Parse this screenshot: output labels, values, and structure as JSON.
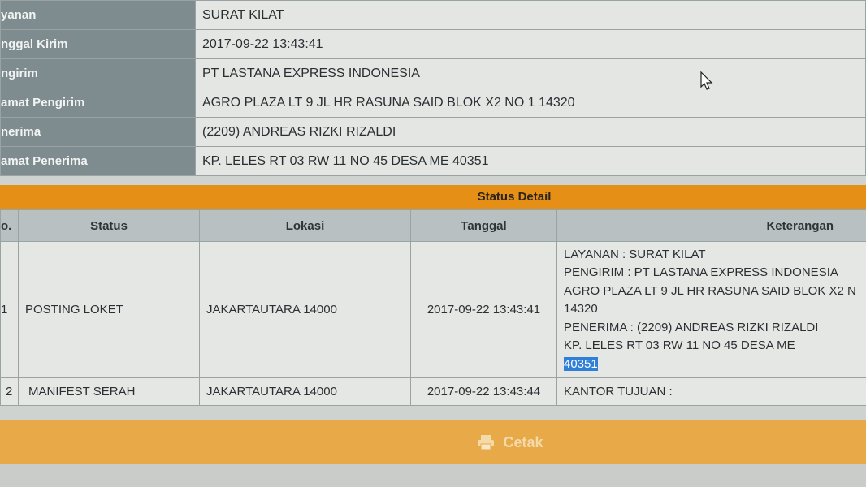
{
  "info": [
    {
      "label": "yanan",
      "value": "SURAT KILAT"
    },
    {
      "label": "nggal Kirim",
      "value": "2017-09-22 13:43:41"
    },
    {
      "label": "ngirim",
      "value": "PT LASTANA EXPRESS INDONESIA"
    },
    {
      "label": "amat Pengirim",
      "value": "AGRO PLAZA LT 9 JL HR RASUNA SAID BLOK X2 NO 1 14320"
    },
    {
      "label": "nerima",
      "value": "(2209) ANDREAS RIZKI RIZALDI"
    },
    {
      "label": "amat Penerima",
      "value": "KP. LELES RT 03 RW 11 NO 45 DESA ME 40351"
    }
  ],
  "status_detail": {
    "title": "Status Detail",
    "headers": {
      "no": "o.",
      "status": "Status",
      "lokasi": "Lokasi",
      "tanggal": "Tanggal",
      "keterangan": "Keterangan"
    },
    "rows": [
      {
        "no": "1",
        "status": "POSTING LOKET",
        "lokasi": "JAKARTAUTARA 14000",
        "tanggal": "2017-09-22 13:43:41",
        "keterangan": [
          "LAYANAN : SURAT KILAT",
          "PENGIRIM : PT LASTANA EXPRESS INDONESIA",
          "AGRO PLAZA LT 9 JL HR RASUNA SAID BLOK X2 N",
          "14320",
          "PENERIMA : (2209) ANDREAS RIZKI RIZALDI",
          "KP. LELES RT 03 RW 11 NO 45 DESA ME",
          "40351"
        ]
      },
      {
        "no": "2",
        "status": "MANIFEST SERAH",
        "lokasi": "JAKARTAUTARA 14000",
        "tanggal": "2017-09-22 13:43:44",
        "keterangan": "KANTOR TUJUAN :"
      }
    ]
  },
  "footer": {
    "print_label": "Cetak",
    "print_icon": "printer-icon"
  },
  "colors": {
    "header_orange": "#e68f17",
    "footer_orange": "#e8a948",
    "label_bg": "#7f8c8f",
    "selection": "#2f7fd8"
  }
}
